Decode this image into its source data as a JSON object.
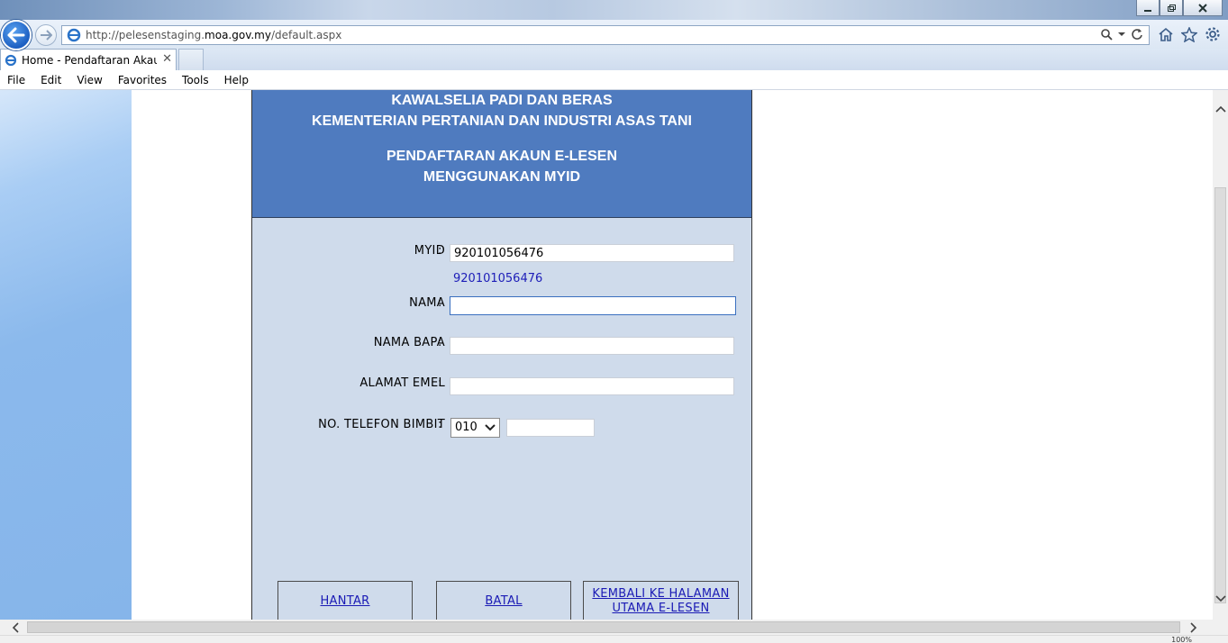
{
  "browser": {
    "url_prefix": "http://pelesenstaging.",
    "url_domain": "moa.gov.my",
    "url_suffix": "/default.aspx",
    "tab_title": "Home - Pendaftaran Akaun...",
    "tab_close": "✕",
    "menu": [
      "File",
      "Edit",
      "View",
      "Favorites",
      "Tools",
      "Help"
    ],
    "zoom": "100%"
  },
  "header": {
    "line1": "KAWALSELIA PADI DAN BERAS",
    "line2": "KEMENTERIAN PERTANIAN DAN INDUSTRI ASAS TANI",
    "line3": "PENDAFTARAN AKAUN E-LESEN",
    "line4": "MENGGUNAKAN MYID"
  },
  "form": {
    "myid_label": "MYID",
    "myid_value": "920101056476",
    "myid_echo": "920101056476",
    "nama_label": "NAMA",
    "nama_value": "",
    "nama_bapa_label": "NAMA BAPA",
    "nama_bapa_value": "",
    "emel_label": "ALAMAT EMEL",
    "emel_value": "",
    "telefon_label": "NO. TELEFON BIMBIT",
    "telefon_prefix": "010",
    "telefon_value": "",
    "colon": ":"
  },
  "buttons": {
    "hantar": "HANTAR",
    "batal": "BATAL",
    "kembali_line1": "KEMBALI KE HALAMAN",
    "kembali_line2": "UTAMA E-LESEN"
  },
  "colors": {
    "header_blue": "#4f7bbf",
    "panel_bg": "#cfdbeb",
    "link": "#1a1ab5"
  }
}
